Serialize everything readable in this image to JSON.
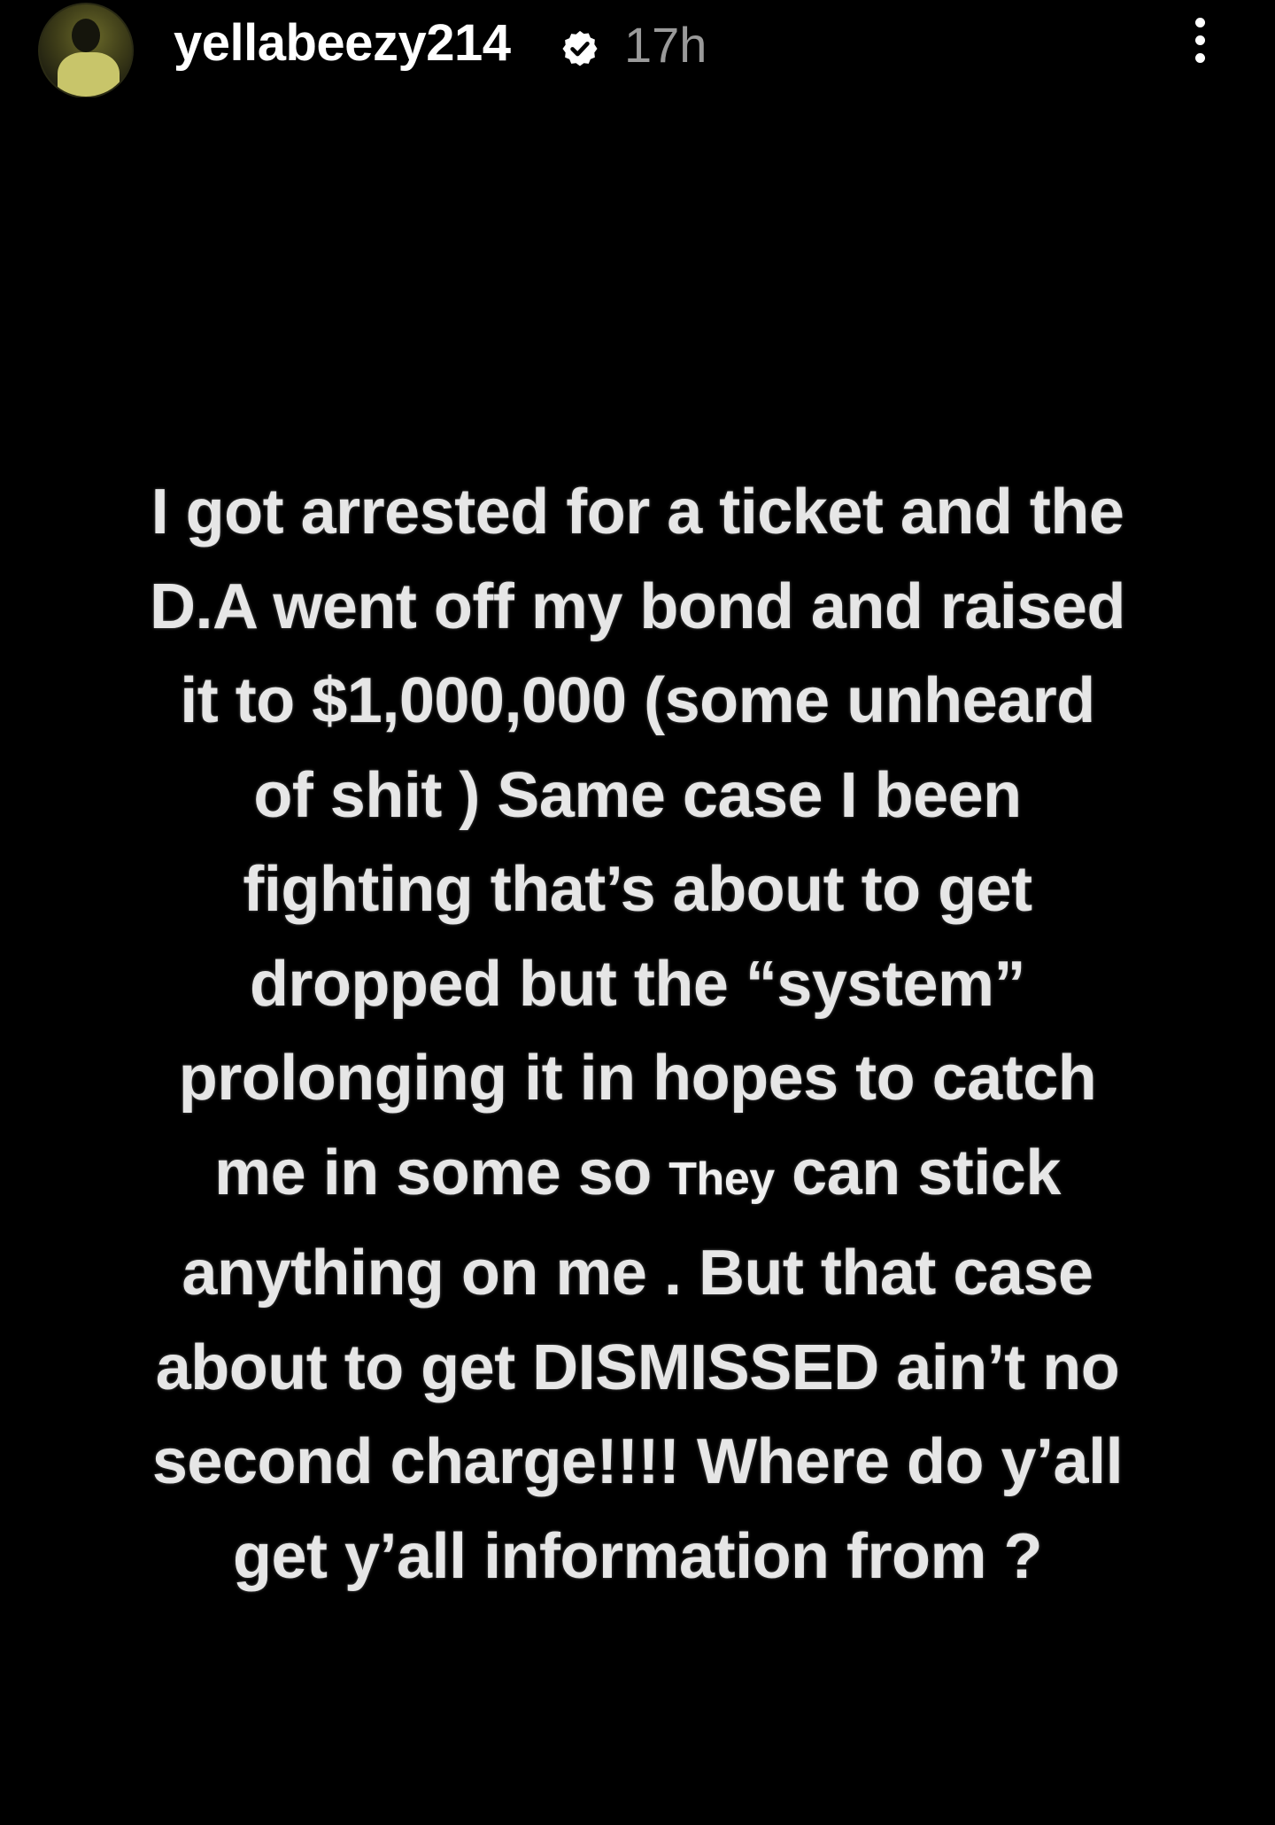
{
  "header": {
    "username": "yellabeezy214",
    "timestamp": "17h",
    "avatar_icon": "profile-avatar",
    "verified_icon": "verified-badge-icon",
    "more_icon": "more-options-icon"
  },
  "story": {
    "lines": [
      "I got arrested for a ticket and the",
      "D.A went off my bond and raised",
      "it to $1,000,000 (some unheard",
      "of shit ) Same case I been",
      "fighting that’s about to get",
      "dropped but the “system”",
      "prolonging it in hopes to catch"
    ],
    "line8_before": "me in some so ",
    "line8_small": "They",
    "line8_after": " can stick",
    "lines_end": [
      "anything on me . But that case",
      "about to get DISMISSED ain’t no",
      "second charge!!!! Where do y’all",
      "get y’all information from ?"
    ]
  },
  "colors": {
    "background": "#000000",
    "text": "#e6e6e6",
    "timestamp": "#9a9a9a"
  }
}
